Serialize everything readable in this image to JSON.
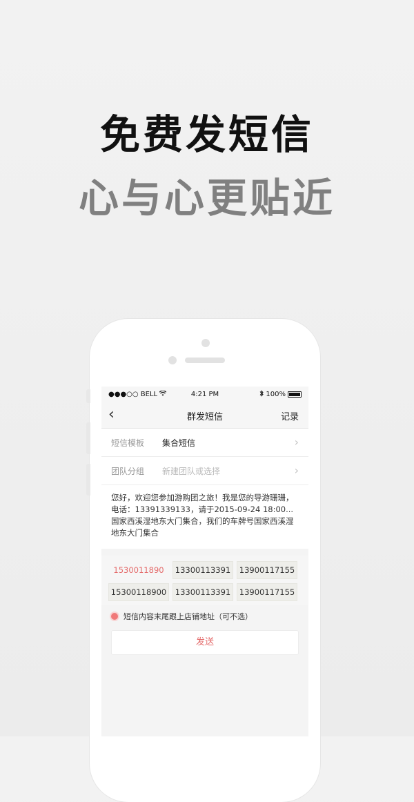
{
  "promo": {
    "headline_1": "免费发短信",
    "headline_2": "心与心更贴近"
  },
  "status_bar": {
    "carrier": "●●●○○ BELL",
    "time": "4:21 PM",
    "battery": "100%"
  },
  "nav": {
    "title": "群发短信",
    "right_action": "记录"
  },
  "form": {
    "template_label": "短信模板",
    "template_value": "集合短信",
    "group_label": "团队分组",
    "group_placeholder": "新建团队或选择"
  },
  "message_text": "您好，欢迎您参加游购团之旅！我是您的导游珊珊，电话：13391339133，请于2015-09-24 18:00...国家西溪湿地东大门集合，我们的车牌号国家西溪湿地东大门集合",
  "numbers": [
    {
      "value": "1530011890",
      "active": true
    },
    {
      "value": "13300113391",
      "active": false
    },
    {
      "value": "13900117155",
      "active": false
    },
    {
      "value": "15300118900",
      "active": false
    },
    {
      "value": "13300113391",
      "active": false
    },
    {
      "value": "13900117155",
      "active": false
    }
  ],
  "option_label": "短信内容末尾跟上店铺地址（可不选）",
  "send_label": "发送",
  "colors": {
    "accent": "#e46b6b",
    "background": "#f0f0f0"
  },
  "icons": [
    "wifi-icon",
    "bluetooth-icon",
    "battery-icon",
    "back-chevron-icon",
    "chevron-right-icon",
    "radio-icon"
  ]
}
